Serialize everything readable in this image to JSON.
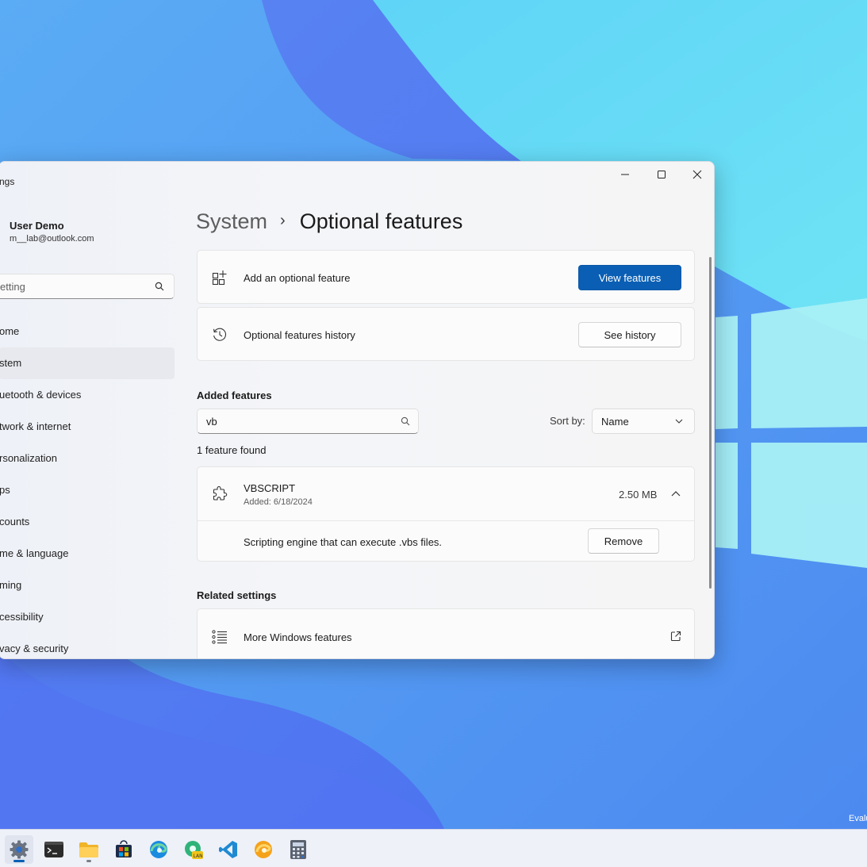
{
  "window": {
    "app_title": "ngs",
    "minimize_icon": "minimize-icon",
    "maximize_icon": "maximize-icon",
    "close_icon": "close-icon"
  },
  "user": {
    "name": "User Demo",
    "email": "m__lab@outlook.com"
  },
  "sidebar": {
    "search_placeholder": "etting",
    "items": [
      {
        "label": "ome",
        "selected": false
      },
      {
        "label": "stem",
        "selected": true
      },
      {
        "label": "uetooth & devices",
        "selected": false
      },
      {
        "label": "twork & internet",
        "selected": false
      },
      {
        "label": "rsonalization",
        "selected": false
      },
      {
        "label": "ps",
        "selected": false
      },
      {
        "label": "counts",
        "selected": false
      },
      {
        "label": "me & language",
        "selected": false
      },
      {
        "label": "ming",
        "selected": false
      },
      {
        "label": "cessibility",
        "selected": false
      },
      {
        "label": "vacy & security",
        "selected": false
      }
    ]
  },
  "breadcrumb": {
    "parent": "System",
    "separator": "›",
    "current": "Optional features"
  },
  "add_feature": {
    "label": "Add an optional feature",
    "button": "View features"
  },
  "history": {
    "label": "Optional features history",
    "button": "See history"
  },
  "added_features": {
    "title": "Added features",
    "filter_value": "vb",
    "sort_label": "Sort by:",
    "sort_value": "Name",
    "count_text": "1 feature found",
    "items": [
      {
        "name": "VBSCRIPT",
        "added": "Added: 6/18/2024",
        "size": "2.50 MB",
        "description": "Scripting engine that can execute .vbs files.",
        "action": "Remove",
        "expanded": true
      }
    ]
  },
  "related": {
    "title": "Related settings",
    "items": [
      {
        "label": "More Windows features"
      }
    ]
  },
  "taskbar": {
    "apps": [
      "settings-app",
      "terminal-app",
      "file-explorer-app",
      "store-app",
      "edge-app",
      "edge-canary-app",
      "vscode-app",
      "edge-dev-app",
      "calculator-app"
    ]
  },
  "desktop": {
    "watermark": "Evalu"
  },
  "colors": {
    "accent": "#0a5fb4",
    "window_bg": "#f3f3f3",
    "card_bg": "#fbfbfb"
  }
}
